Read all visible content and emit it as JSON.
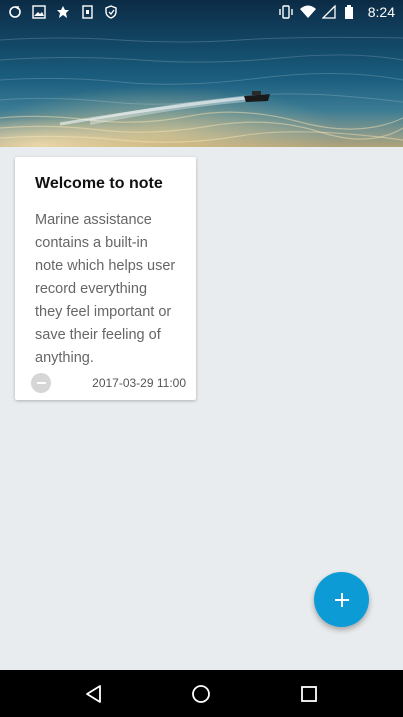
{
  "status_bar": {
    "time": "8:24",
    "left_icons": [
      "sync-icon",
      "image-icon",
      "leaf-icon",
      "sim-icon",
      "shield-icon"
    ],
    "right_icons": [
      "vibrate-icon",
      "wifi-icon",
      "signal-icon",
      "battery-icon"
    ]
  },
  "note": {
    "title": "Welcome to note",
    "body": "Marine assistance contains a built-in note which helps user record everything they feel important or save their feeling of anything.",
    "date": "2017-03-29 11:00"
  },
  "fab": {
    "icon": "plus-icon"
  },
  "nav_bar": {
    "icons": [
      "back-icon",
      "home-icon",
      "recents-icon"
    ]
  },
  "colors": {
    "background": "#e9ecee",
    "fab": "#0d9bd6",
    "card": "#ffffff",
    "title_text": "#111111",
    "body_text": "#666666"
  }
}
